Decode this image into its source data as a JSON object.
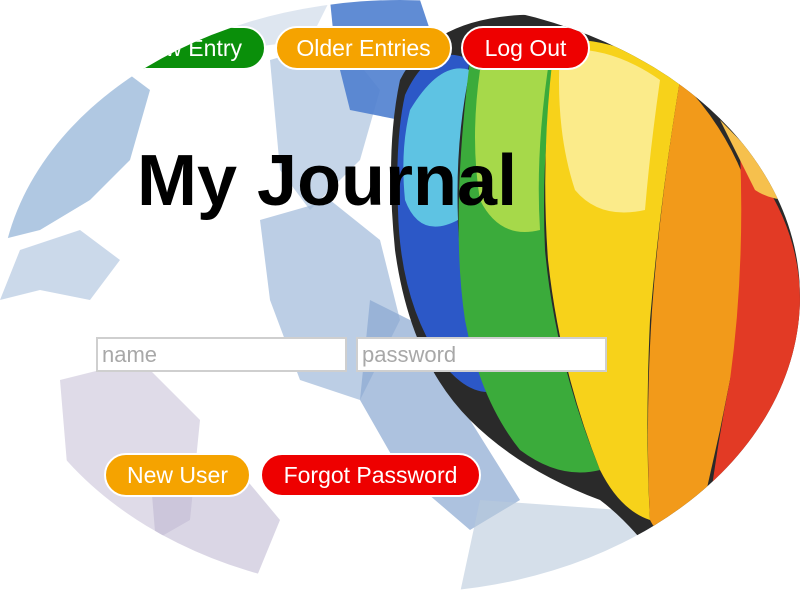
{
  "nav": {
    "new_entry_label": "New Entry",
    "older_entries_label": "Older Entries",
    "log_out_label": "Log Out"
  },
  "page": {
    "title": "My Journal"
  },
  "login": {
    "name_placeholder": "name",
    "password_placeholder": "password",
    "new_user_label": "New User",
    "forgot_password_label": "Forgot Password"
  },
  "colors": {
    "green_button": "#0a8f0a",
    "orange_button": "#f5a300",
    "red_button": "#ee0000"
  }
}
